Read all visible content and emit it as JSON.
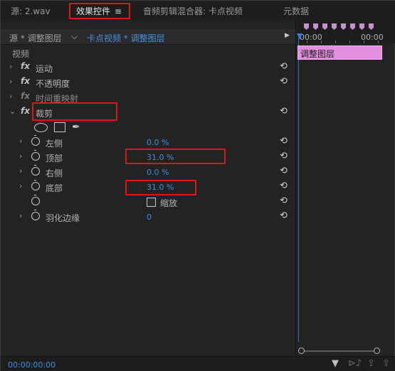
{
  "tabs": {
    "source": "源: 2.wav",
    "effect_controls": "效果控件",
    "menu_glyph": "≡",
    "audio_mixer": "音频剪辑混合器: 卡点视频",
    "metadata": "元数据"
  },
  "header": {
    "source_label": "源 * 调整图层",
    "dropdown_glyph": "⌵",
    "clip_label": "卡点视频 * 调整图层",
    "play_glyph": "▶"
  },
  "timeline": {
    "start_time": "00:00",
    "end_time": "00:00",
    "clip_name": "调整图层",
    "marker_count": 8,
    "marker_color": "#c88fd0",
    "clip_color": "#e28fe0"
  },
  "section_label": "视频",
  "effects": [
    {
      "name": "运动",
      "fx": "fx",
      "chevron": "›",
      "reset": "⟲"
    },
    {
      "name": "不透明度",
      "fx": "fx",
      "chevron": "›",
      "reset": "⟲"
    },
    {
      "name": "时间重映射",
      "fx": "fx",
      "chevron": "›"
    },
    {
      "name": "裁剪",
      "fx": "fx",
      "chevron": "⌄",
      "reset": "⟲"
    }
  ],
  "crop_params": [
    {
      "name": "左侧",
      "value": "0.0 %",
      "chevron": "›",
      "reset": "⟲"
    },
    {
      "name": "顶部",
      "value": "31.0 %",
      "chevron": "›",
      "reset": "⟲"
    },
    {
      "name": "右侧",
      "value": "0.0 %",
      "chevron": "›",
      "reset": "⟲"
    },
    {
      "name": "底部",
      "value": "31.0 %",
      "chevron": "›",
      "reset": "⟲"
    }
  ],
  "zoom": {
    "label": "缩放",
    "checked": false,
    "reset": "⟲"
  },
  "feather": {
    "name": "羽化边缘",
    "value": "0",
    "chevron": "›",
    "reset": "⟲"
  },
  "tools": {
    "pen_glyph": "✒"
  },
  "footer": {
    "timecode": "00:00:00:00",
    "filter_glyph": "▼",
    "audio_glyph": "⊳♪",
    "export_glyph": "⇪",
    "share_glyph": "⇧"
  },
  "colors": {
    "accent_blue": "#3e8fe0",
    "highlight_red": "#e0141a"
  }
}
